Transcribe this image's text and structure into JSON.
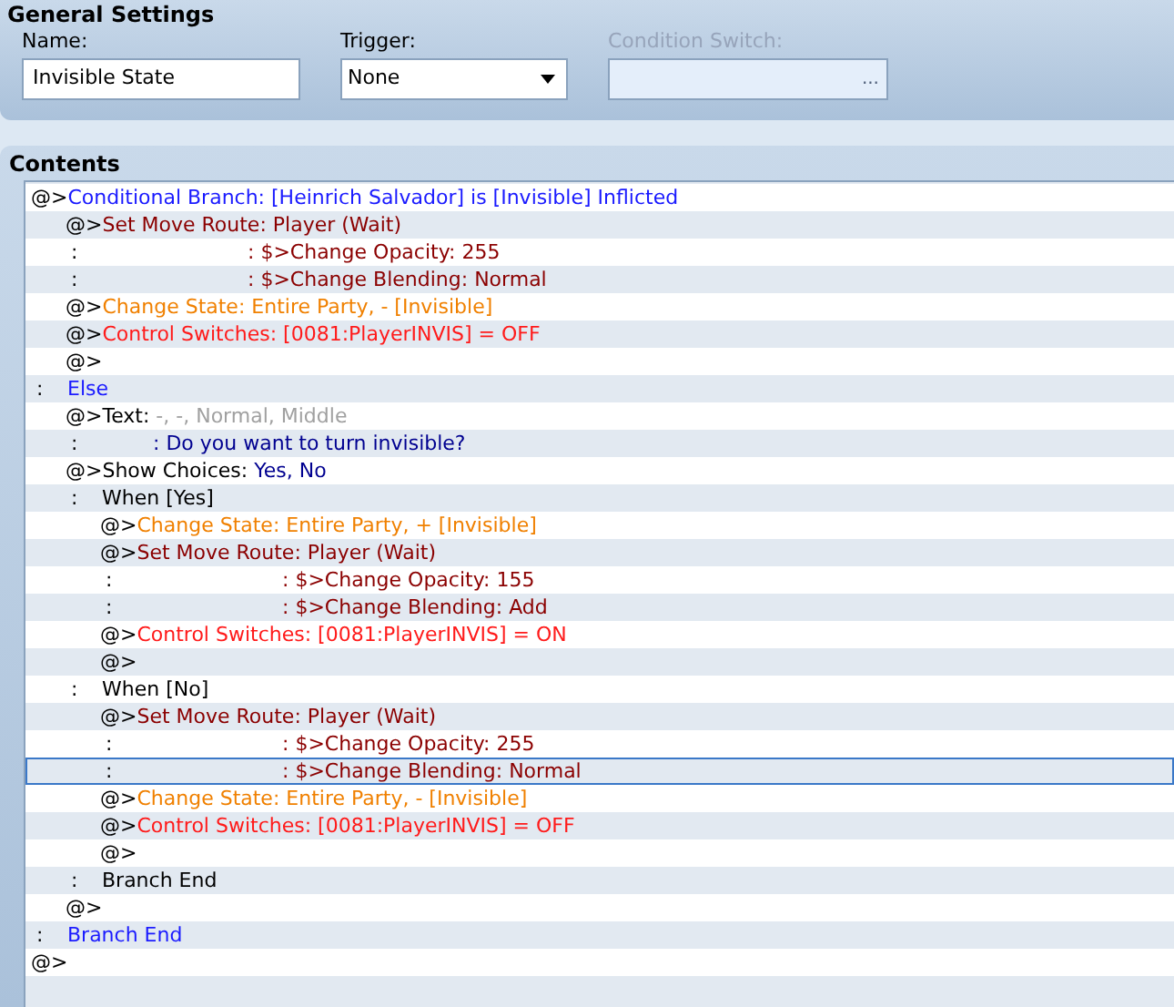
{
  "general_settings": {
    "title": "General Settings",
    "name": {
      "label": "Name:",
      "value": "Invisible State"
    },
    "trigger": {
      "label": "Trigger:",
      "value": "None"
    },
    "condition_switch": {
      "label": "Condition Switch:",
      "disabled": true,
      "button": "..."
    }
  },
  "contents": {
    "title": "Contents",
    "commands": [
      {
        "marker": "@>",
        "selected": false,
        "parts": [
          {
            "text": "Conditional Branch: [Heinrich Salvador] is [Invisible] Inflicted",
            "kind": "branch"
          }
        ],
        "children": [
          {
            "marker": "@>",
            "selected": false,
            "parts": [
              {
                "text": "Set Move Route: Player (Wait)",
                "kind": "route"
              }
            ]
          },
          {
            "marker": ":",
            "selected": false,
            "parts": [
              {
                "text": ": $>Change Opacity: 255",
                "kind": "route-cont"
              }
            ]
          },
          {
            "marker": ":",
            "selected": false,
            "parts": [
              {
                "text": ": $>Change Blending: Normal",
                "kind": "route-cont"
              }
            ]
          },
          {
            "marker": "@>",
            "selected": false,
            "parts": [
              {
                "text": "Change State: Entire Party, - [Invisible]",
                "kind": "state"
              }
            ]
          },
          {
            "marker": "@>",
            "selected": false,
            "parts": [
              {
                "text": "Control Switches: [0081:PlayerINVIS] = OFF",
                "kind": "switch"
              }
            ]
          },
          {
            "marker": "@>",
            "selected": false
          }
        ]
      },
      {
        "marker": ":",
        "selected": false,
        "parts": [
          {
            "text": "Else",
            "kind": "branch"
          }
        ],
        "children": [
          {
            "marker": "@>",
            "selected": false,
            "parts": [
              {
                "text": "Text: ",
                "kind": "plain"
              },
              {
                "text": "-, -, Normal, Middle",
                "kind": "dim"
              }
            ]
          },
          {
            "marker": ":",
            "selected": false,
            "parts": [
              {
                "text": ": Do you want to turn invisible?",
                "kind": "message-cont"
              }
            ]
          },
          {
            "marker": "@>",
            "selected": false,
            "parts": [
              {
                "text": "Show Choices: ",
                "kind": "plain"
              },
              {
                "text": "Yes, No",
                "kind": "message"
              }
            ]
          },
          {
            "marker": ":",
            "selected": false,
            "parts": [
              {
                "text": "When [Yes]",
                "kind": "plain"
              }
            ],
            "children": [
              {
                "marker": "@>",
                "selected": false,
                "parts": [
                  {
                    "text": "Change State: Entire Party, + [Invisible]",
                    "kind": "state"
                  }
                ]
              },
              {
                "marker": "@>",
                "selected": false,
                "parts": [
                  {
                    "text": "Set Move Route: Player (Wait)",
                    "kind": "route"
                  }
                ]
              },
              {
                "marker": ":",
                "selected": false,
                "parts": [
                  {
                    "text": ": $>Change Opacity: 155",
                    "kind": "route-cont"
                  }
                ]
              },
              {
                "marker": ":",
                "selected": false,
                "parts": [
                  {
                    "text": ": $>Change Blending: Add",
                    "kind": "route-cont"
                  }
                ]
              },
              {
                "marker": "@>",
                "selected": false,
                "parts": [
                  {
                    "text": "Control Switches: [0081:PlayerINVIS] = ON",
                    "kind": "switch"
                  }
                ]
              },
              {
                "marker": "@>",
                "selected": false
              }
            ]
          },
          {
            "marker": ":",
            "selected": false,
            "parts": [
              {
                "text": "When [No]",
                "kind": "plain"
              }
            ],
            "children": [
              {
                "marker": "@>",
                "selected": false,
                "parts": [
                  {
                    "text": "Set Move Route: Player (Wait)",
                    "kind": "route"
                  }
                ]
              },
              {
                "marker": ":",
                "selected": false,
                "parts": [
                  {
                    "text": ": $>Change Opacity: 255",
                    "kind": "route-cont"
                  }
                ]
              },
              {
                "marker": ":",
                "selected": true,
                "parts": [
                  {
                    "text": ": $>Change Blending: Normal",
                    "kind": "route-cont"
                  }
                ]
              },
              {
                "marker": "@>",
                "selected": false,
                "parts": [
                  {
                    "text": "Change State: Entire Party, - [Invisible]",
                    "kind": "state"
                  }
                ]
              },
              {
                "marker": "@>",
                "selected": false,
                "parts": [
                  {
                    "text": "Control Switches: [0081:PlayerINVIS] = OFF",
                    "kind": "switch"
                  }
                ]
              },
              {
                "marker": "@>",
                "selected": false
              }
            ]
          },
          {
            "marker": ":",
            "selected": false,
            "parts": [
              {
                "text": "Branch End",
                "kind": "plain"
              }
            ]
          },
          {
            "marker": "@>",
            "selected": false
          }
        ]
      },
      {
        "marker": ":",
        "selected": false,
        "parts": [
          {
            "text": "Branch End",
            "kind": "branch"
          }
        ]
      },
      {
        "marker": "@>",
        "selected": false
      }
    ]
  }
}
